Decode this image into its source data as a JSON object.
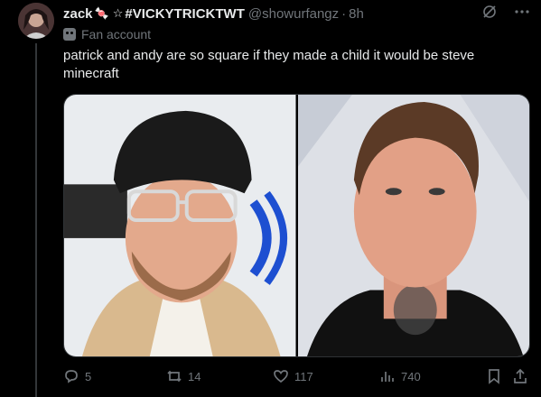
{
  "tweet": {
    "display_name": "zack",
    "name_emoji_1": "🍬",
    "name_emoji_2": "☆",
    "name_suffix": "#VICKYTRICKTWT",
    "handle": "@showurfangz",
    "separator": "·",
    "time": "8h",
    "label": "Fan account",
    "text": "patrick and andy are so square if they made a child it would be steve minecraft"
  },
  "actions": {
    "replies": "5",
    "retweets": "14",
    "likes": "117",
    "views": "740"
  },
  "icons": {
    "grok": "grok-icon",
    "more": "more-icon",
    "label": "mask-icon",
    "reply": "reply-icon",
    "retweet": "retweet-icon",
    "like": "heart-icon",
    "views": "views-icon",
    "bookmark": "bookmark-icon",
    "share": "share-icon"
  },
  "colors": {
    "background": "#000000",
    "text": "#e7e9ea",
    "secondary": "#71767b",
    "border": "#2f3336"
  }
}
